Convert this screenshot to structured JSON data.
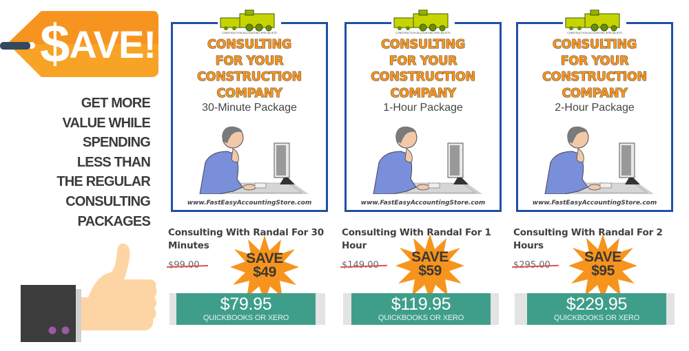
{
  "promo": {
    "tag_dollar": "$",
    "tag_text": "AVE!",
    "headline_lines": [
      "GET MORE",
      "VALUE WHILE",
      "SPENDING",
      "LESS THAN",
      "THE REGULAR",
      "CONSULTING",
      "PACKAGES"
    ],
    "icons": {
      "tag": "price-tag-icon",
      "thumb": "thumbs-up-icon"
    }
  },
  "colors": {
    "tag_orange": "#f7a325",
    "tag_orange_dark": "#f79420",
    "frame_blue": "#1f4fa8",
    "buy_green": "#3f9e8a",
    "starburst": "#f7941d",
    "strike_red": "#d9534f"
  },
  "products": [
    {
      "cover": {
        "logo_caption": "CONSTRUCTION ACCOUNTING SPECIALISTS",
        "title_lines": [
          "CONSULTING",
          "FOR YOUR",
          "CONSTRUCTION",
          "COMPANY"
        ],
        "package": "30-Minute Package",
        "url": "www.FastEasyAccountingStore.com"
      },
      "title": "Consulting With Randal For 30 Minutes",
      "old_price": "$99.00",
      "save_label": "SAVE",
      "save_amount": "$49",
      "price": "$79.95",
      "price_sub": "QUICKBOOKS OR XERO"
    },
    {
      "cover": {
        "logo_caption": "CONSTRUCTION ACCOUNTING SPECIALISTS",
        "title_lines": [
          "CONSULTING",
          "FOR YOUR",
          "CONSTRUCTION",
          "COMPANY"
        ],
        "package": "1-Hour Package",
        "url": "www.FastEasyAccountingStore.com"
      },
      "title": "Consulting With Randal For 1 Hour",
      "old_price": "$149.00",
      "save_label": "SAVE",
      "save_amount": "$59",
      "price": "$119.95",
      "price_sub": "QUICKBOOKS OR XERO"
    },
    {
      "cover": {
        "logo_caption": "CONSTRUCTION ACCOUNTING SPECIALISTS",
        "title_lines": [
          "CONSULTING",
          "FOR YOUR",
          "CONSTRUCTION",
          "COMPANY"
        ],
        "package": "2-Hour Package",
        "url": "www.FastEasyAccountingStore.com"
      },
      "title": "Consulting With Randal For 2 Hours",
      "old_price": "$295.00",
      "save_label": "SAVE",
      "save_amount": "$95",
      "price": "$229.95",
      "price_sub": "QUICKBOOKS OR XERO"
    }
  ]
}
